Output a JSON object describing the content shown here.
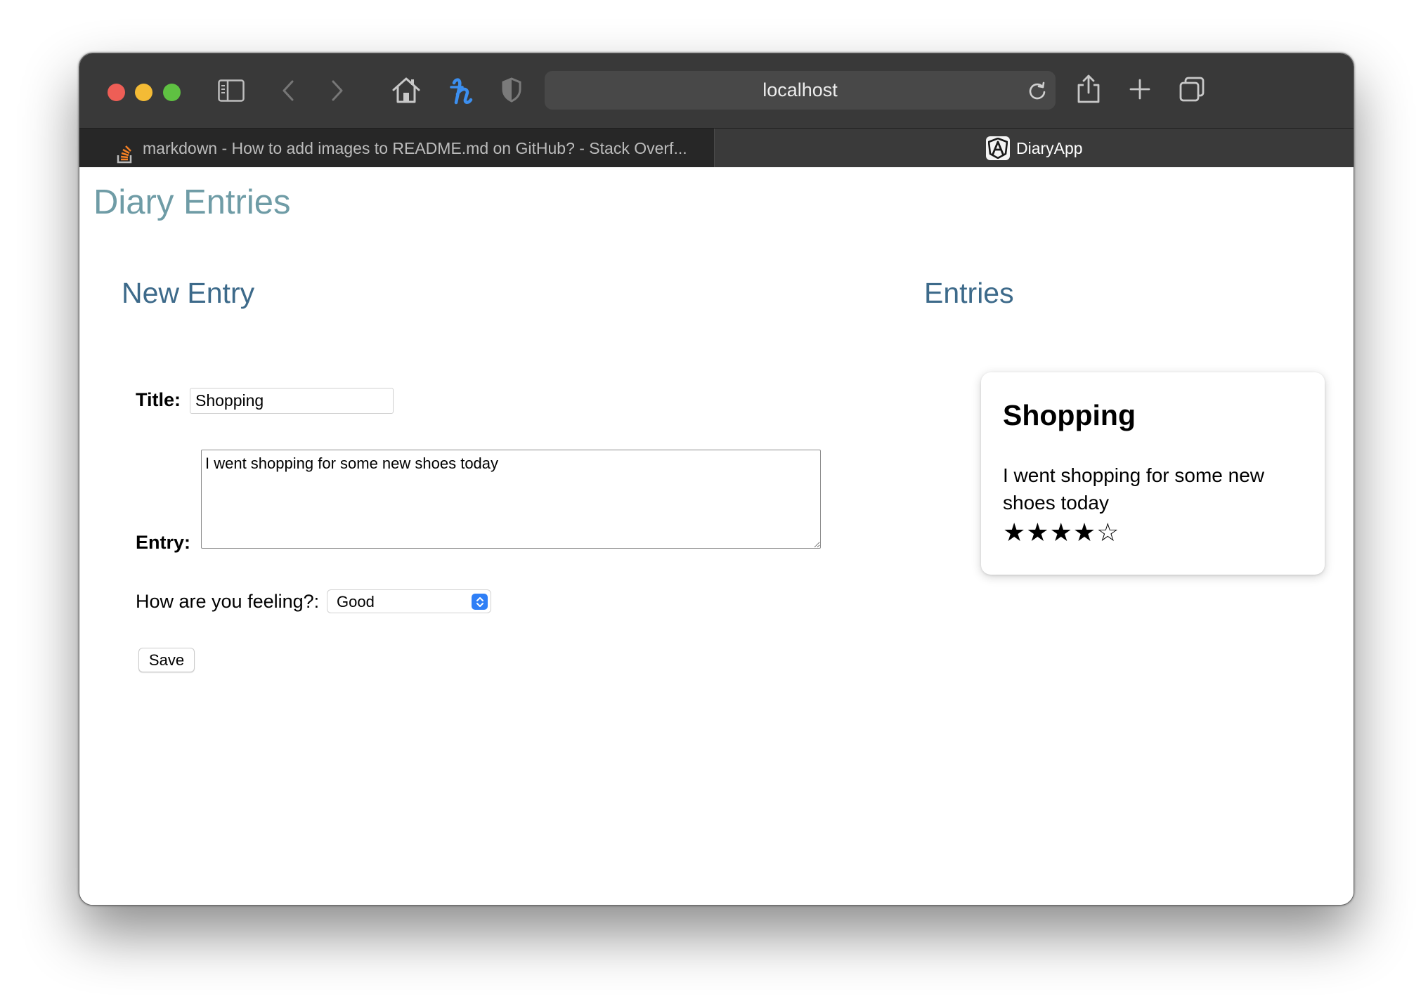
{
  "browser": {
    "url": "localhost",
    "tabs": [
      {
        "label": "markdown - How to add images to README.md on GitHub? - Stack Overf...",
        "icon": "stackoverflow-icon",
        "active": false
      },
      {
        "label": "DiaryApp",
        "icon": "angular-icon",
        "active": true
      }
    ]
  },
  "page": {
    "title": "Diary Entries",
    "new_entry_heading": "New Entry",
    "entries_heading": "Entries"
  },
  "form": {
    "title_label": "Title:",
    "title_value": "Shopping",
    "entry_label": "Entry:",
    "entry_value": "I went shopping for some new shoes today",
    "feeling_label": "How are you feeling?:",
    "feeling_value": "Good",
    "save_label": "Save"
  },
  "entries": [
    {
      "title": "Shopping",
      "text": "I went shopping for some new shoes today",
      "rating": 4,
      "max_rating": 5
    }
  ],
  "colors": {
    "page_title": "#6f9ca6",
    "section_heading": "#3d6a8a",
    "select_accent": "#2f7ff6"
  }
}
